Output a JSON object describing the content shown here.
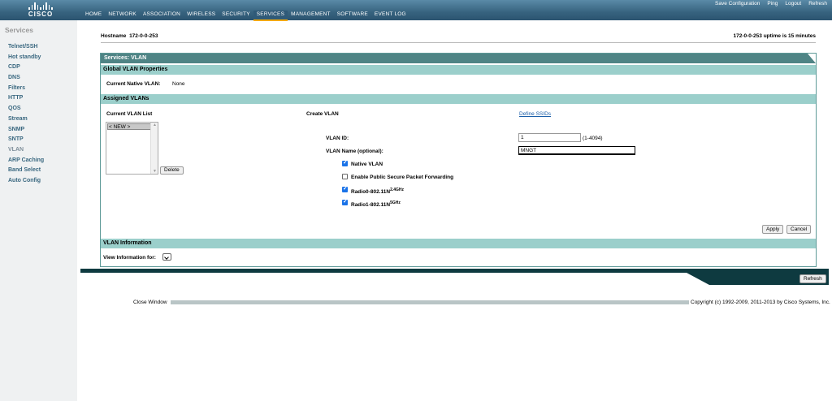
{
  "brand": {
    "logo_text": "CISCO"
  },
  "top_links": [
    "Save Configuration",
    "Ping",
    "Logout",
    "Refresh"
  ],
  "nav": [
    "HOME",
    "NETWORK",
    "ASSOCIATION",
    "WIRELESS",
    "SECURITY",
    "SERVICES",
    "MANAGEMENT",
    "SOFTWARE",
    "EVENT LOG"
  ],
  "active_nav": "SERVICES",
  "sidebar": {
    "title": "Services",
    "items": [
      "Telnet/SSH",
      "Hot standby",
      "CDP",
      "DNS",
      "Filters",
      "HTTP",
      "QOS",
      "Stream",
      "SNMP",
      "SNTP",
      "VLAN",
      "ARP Caching",
      "Band Select",
      "Auto Config"
    ],
    "current": "VLAN"
  },
  "host": {
    "label": "Hostname",
    "name": "172-0-0-253",
    "uptime": "172-0-0-253 uptime is 15 minutes"
  },
  "panel": {
    "title": "Services: VLAN",
    "global_section": "Global VLAN Properties",
    "native_vlan_label": "Current Native VLAN:",
    "native_vlan_value": "None",
    "assigned_section": "Assigned VLANs",
    "current_list_label": "Current VLAN List",
    "list_items": [
      "< NEW >"
    ],
    "delete_label": "Delete",
    "create_label": "Create VLAN",
    "define_ssids": "Define SSIDs",
    "vlan_id_label": "VLAN ID:",
    "vlan_id_value": "1",
    "vlan_id_range": "(1-4094)",
    "vlan_name_label": "VLAN Name (optional):",
    "vlan_name_value": "MNGT",
    "checkboxes": [
      {
        "label": "Native VLAN",
        "checked": true
      },
      {
        "label": "Enable Public Secure Packet Forwarding",
        "checked": false
      },
      {
        "label": "Radio0-802.11N",
        "sup": "2.4GHz",
        "checked": true
      },
      {
        "label": "Radio1-802.11N",
        "sup": "5GHz",
        "checked": true
      }
    ],
    "apply_label": "Apply",
    "cancel_label": "Cancel",
    "info_section": "VLAN Information",
    "view_info_label": "View Information for:"
  },
  "footer": {
    "refresh": "Refresh",
    "close_window": "Close Window",
    "copyright": "Copyright (c) 1992-2009, 2011-2013 by Cisco Systems, Inc."
  }
}
